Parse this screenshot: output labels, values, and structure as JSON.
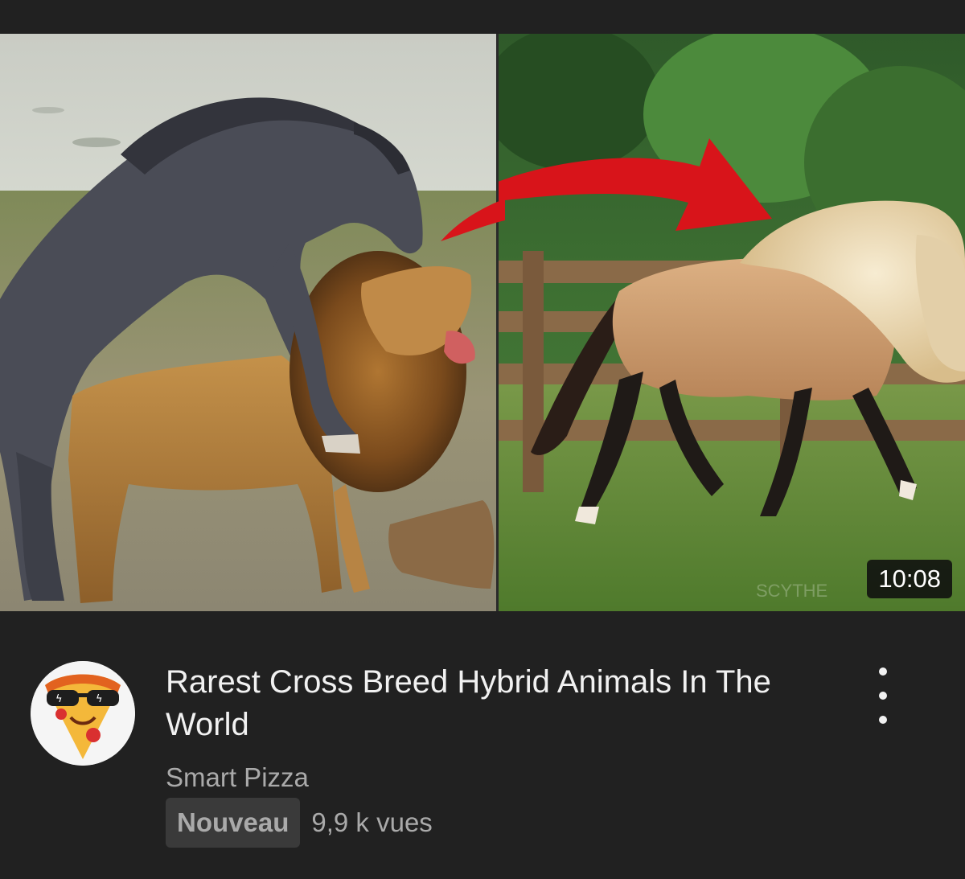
{
  "video": {
    "duration": "10:08",
    "title": "Rarest Cross Breed Hybrid Animals In The World",
    "channel": "Smart Pizza",
    "badge": "Nouveau",
    "views": "9,9 k vues"
  },
  "icons": {
    "menu": "more-vert-icon",
    "avatar": "pizza-slice-sunglasses-icon"
  },
  "colors": {
    "background": "#212121",
    "title_text": "#f1f1f1",
    "secondary_text": "#aaaaaa",
    "badge_bg": "#3a3a3a",
    "arrow_red": "#d8141a"
  }
}
